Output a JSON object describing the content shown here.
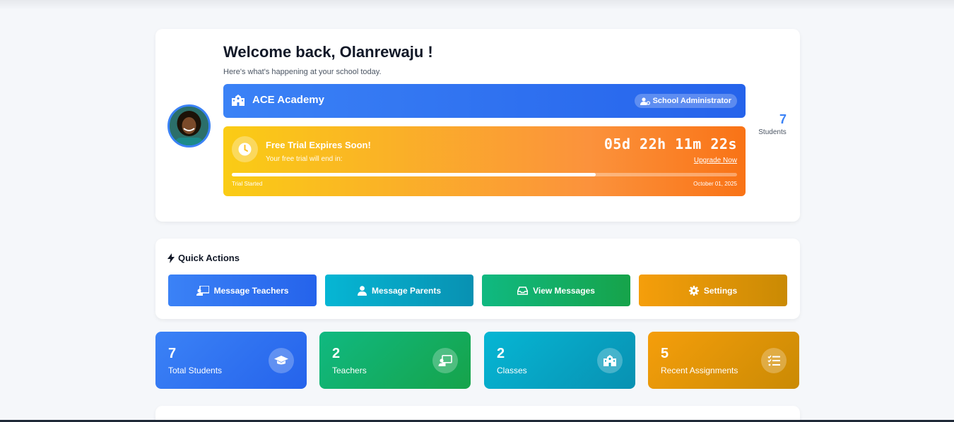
{
  "welcome": {
    "title": "Welcome back, Olanrewaju !",
    "subtitle": "Here's what's happening at your school today.",
    "school_name": "ACE Academy",
    "role_badge": "School Administrator",
    "avatar_icon": "user-avatar"
  },
  "trial": {
    "title": "Free Trial Expires Soon!",
    "subtitle": "Your free trial will end in:",
    "countdown": "05d 22h 11m 22s",
    "upgrade_label": "Upgrade Now",
    "start_label": "Trial Started",
    "end_label": "October 01, 2025",
    "progress_fraction": 0.72
  },
  "side_stat": {
    "value": "7",
    "label": "Students"
  },
  "quick_actions": {
    "title": "Quick Actions",
    "buttons": [
      {
        "label": "Message Teachers",
        "icon": "chalkboard-teacher-icon"
      },
      {
        "label": "Message Parents",
        "icon": "user-icon"
      },
      {
        "label": "View Messages",
        "icon": "inbox-icon"
      },
      {
        "label": "Settings",
        "icon": "gear-icon"
      }
    ]
  },
  "stats": [
    {
      "value": "7",
      "label": "Total Students",
      "icon": "graduation-cap-icon"
    },
    {
      "value": "2",
      "label": "Teachers",
      "icon": "chalkboard-teacher-icon"
    },
    {
      "value": "2",
      "label": "Classes",
      "icon": "school-icon"
    },
    {
      "value": "5",
      "label": "Recent Assignments",
      "icon": "tasks-icon"
    }
  ],
  "colors": {
    "primary": "#3b82f6",
    "cyan": "#06b6d4",
    "green": "#10b981",
    "amber": "#f59e0b",
    "trial_start": "#facc15",
    "trial_end": "#f97316"
  }
}
